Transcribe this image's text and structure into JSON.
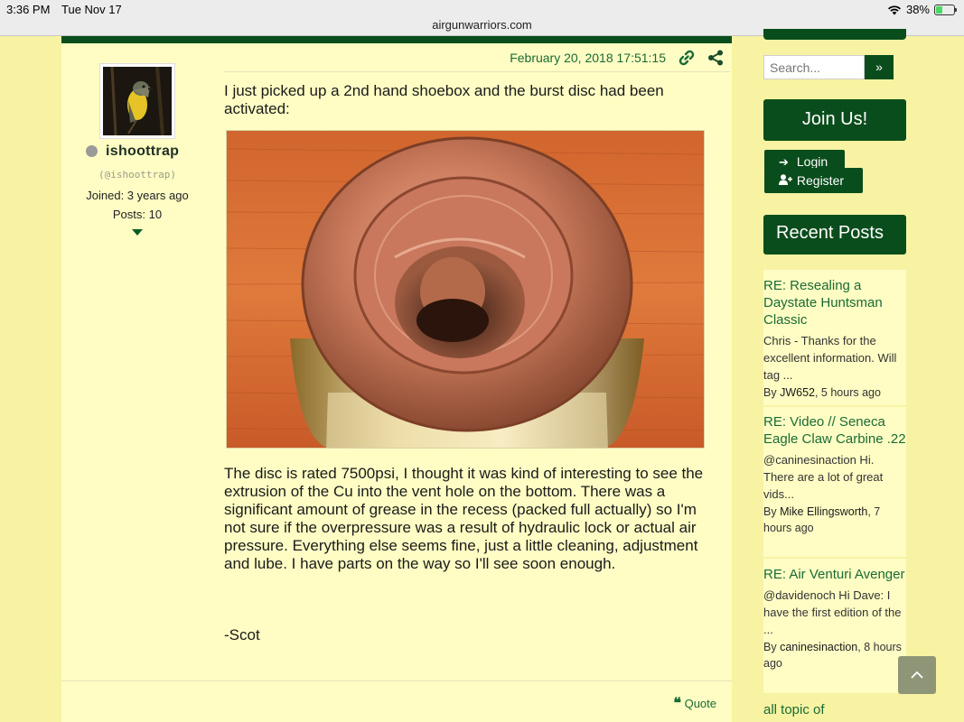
{
  "status_bar": {
    "time": "3:36 PM",
    "date": "Tue Nov 17",
    "url": "airgunwarriors.com",
    "battery": "38%",
    "battery_level": 0.38,
    "icons": [
      "wifi-icon",
      "battery-icon"
    ]
  },
  "post": {
    "date": "February 20, 2018 17:51:15",
    "author": {
      "username": "ishoottrap",
      "handle": "(@ishoottrap)",
      "joined": "Joined: 3 years ago",
      "posts": "Posts: 10"
    },
    "intro": "I just picked up a 2nd hand shoebox and the burst disc had been activated:",
    "body": "The disc is rated 7500psi, I thought it was kind of interesting to see the extrusion of the Cu into the vent hole on the bottom. There was a significant amount of grease in the recess (packed full actually) so I'm not sure if the overpressure was a result of hydraulic lock or actual air pressure. Everything else seems fine, just a little cleaning, adjustment and lube. I have parts on the way so I'll see soon enough.",
    "signoff": "-Scot",
    "quote_label": "Quote",
    "icons": [
      "link-icon",
      "share-icon",
      "quote-icon",
      "chevron-down-icon"
    ]
  },
  "sidebar": {
    "search_placeholder": "Search...",
    "search_button": "»",
    "join_label": "Join Us!",
    "login_label": "Login",
    "register_label": "Register",
    "recent_title": "Recent Posts",
    "recent_posts": [
      {
        "title": "RE: Resealing a Daystate Huntsman Classic",
        "excerpt": "Chris - Thanks for the excellent information. Will tag ...",
        "by": "By",
        "author": "JW652",
        "time": ", 5 hours ago"
      },
      {
        "title": "RE: Video // Seneca Eagle Claw Carbine .22",
        "excerpt": "@caninesinaction Hi. There are a lot of great vids...",
        "by": "By",
        "author": "Mike Ellingsworth",
        "time": ", 7 hours ago"
      },
      {
        "title": "RE: Air Venturi Avenger",
        "excerpt": "@davidenoch Hi Dave: I have the first edition of the ...",
        "by": "By",
        "author": "caninesinaction",
        "time": ", 8 hours ago"
      },
      {
        "title": "all topic of"
      }
    ]
  },
  "colors": {
    "page_bg": "#f7f3a3",
    "post_bg": "#fffdc4",
    "brand_green": "#0a4d1c",
    "link_green": "#1a6b35"
  }
}
